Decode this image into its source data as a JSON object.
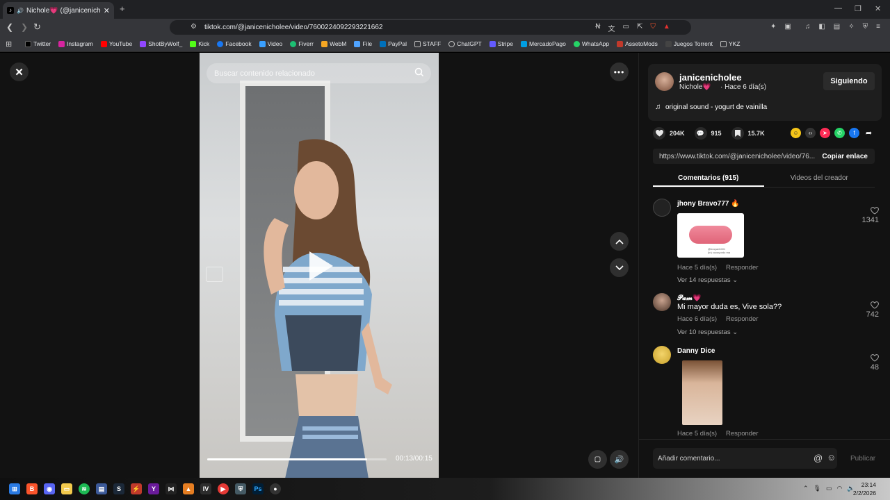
{
  "browser": {
    "tab_title": "Nichole💗 (@janicenicholee)",
    "new_tab": "+",
    "url": "tiktok.com/@janicenicholee/video/7600224092293221662"
  },
  "bookmarks": [
    {
      "label": "Twitter",
      "color": "#000000"
    },
    {
      "label": "Instagram",
      "color": "#d6249f"
    },
    {
      "label": "YouTube",
      "color": "#ff0000"
    },
    {
      "label": "ShotByWolf_",
      "color": "#9147ff"
    },
    {
      "label": "Kick",
      "color": "#53fc18"
    },
    {
      "label": "Facebook",
      "color": "#1877f2"
    },
    {
      "label": "Video",
      "color": "#3aa0ff"
    },
    {
      "label": "Fiverr",
      "color": "#1dbf73"
    },
    {
      "label": "WebM",
      "color": "#f5a623"
    },
    {
      "label": "File",
      "color": "#4fa3ff"
    },
    {
      "label": "PayPal",
      "color": "#0070ba"
    },
    {
      "label": "STAFF",
      "color": "#888888"
    },
    {
      "label": "ChatGPT",
      "color": "#cccccc"
    },
    {
      "label": "Stripe",
      "color": "#635bff"
    },
    {
      "label": "MercadoPago",
      "color": "#009ee3"
    },
    {
      "label": "WhatsApp",
      "color": "#25d366"
    },
    {
      "label": "AssetoMods",
      "color": "#c0392b"
    },
    {
      "label": "Juegos Torrent",
      "color": "#444444"
    },
    {
      "label": "YKZ",
      "color": "#888888"
    }
  ],
  "video": {
    "search_placeholder": "Buscar contenido relacionado",
    "time": "00:13/00:15",
    "progress": 0.89
  },
  "creator": {
    "username": "janicenicholee",
    "display_name": "Nichole💗",
    "posted": "· Hace 6 día(s)",
    "follow_label": "Siguiendo",
    "sound": "original sound - yogurt de vainilla"
  },
  "stats": {
    "likes": "204K",
    "comments": "915",
    "saves": "15.7K"
  },
  "link": {
    "url": "https://www.tiktok.com/@janicenicholee/video/76...",
    "copy_label": "Copiar enlace"
  },
  "panel_tabs": [
    "Comentarios (915)",
    "Videos del creador"
  ],
  "comments": [
    {
      "user": "jhony Bravo777 🔥",
      "text": "",
      "time": "Hace 5 día(s)",
      "reply": "Responder",
      "more": "Ver 14 respuestas",
      "likes": "1341",
      "image_caption": "@brayan0401\n(in) cucayordo ma"
    },
    {
      "user": "𝓟𝓪𝓶💗",
      "text": "Mi mayor duda es, Vive sola??",
      "time": "Hace 6 día(s)",
      "reply": "Responder",
      "more": "Ver 10 respuestas",
      "likes": "742"
    },
    {
      "user": "Danny Dice",
      "text": "",
      "time": "Hace 5 día(s)",
      "reply": "Responder",
      "more": "",
      "likes": "48"
    }
  ],
  "composer": {
    "placeholder": "Añadir comentario...",
    "publish": "Publicar"
  },
  "taskbar": {
    "time": "23:14",
    "date": "2/2/2026"
  }
}
